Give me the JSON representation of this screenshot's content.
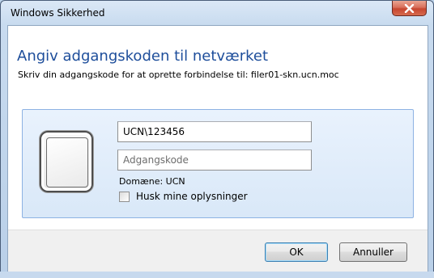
{
  "window": {
    "title": "Windows Sikkerhed"
  },
  "dialog": {
    "heading": "Angiv adgangskoden til netværket",
    "subheading": "Skriv din adgangskode for at oprette forbindelse til: filer01-skn.ucn.moc"
  },
  "credentials": {
    "username_value": "UCN\\123456",
    "password_placeholder": "Adgangskode",
    "domain_label": "Domæne: UCN",
    "remember_label": "Husk mine oplysninger",
    "remember_checked": false
  },
  "buttons": {
    "ok_label": "OK",
    "cancel_label": "Annuller"
  },
  "icons": {
    "close": "close-icon",
    "avatar": "user-tile-icon"
  },
  "colors": {
    "heading": "#1e4e9b",
    "close_button": "#c7462f",
    "panel_border": "#8db2e3"
  }
}
